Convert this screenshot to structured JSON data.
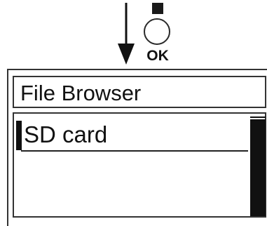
{
  "instruction": {
    "arrow_icon": "down-arrow-icon",
    "button_icon": "ok-button-icon",
    "button_label": "OK"
  },
  "screen": {
    "title": "File Browser",
    "items": [
      {
        "label": "SD card",
        "selected": true
      }
    ],
    "scrollbar": {
      "visible_fraction": 1.0
    }
  },
  "colors": {
    "foreground": "#111111",
    "background": "#ffffff",
    "border": "#333333"
  }
}
